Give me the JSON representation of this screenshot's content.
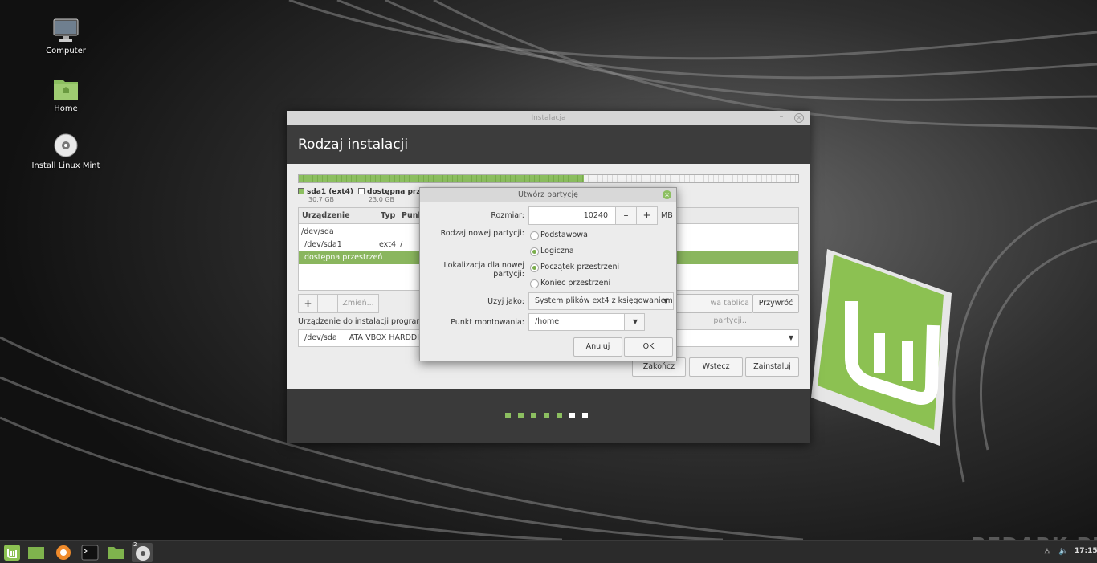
{
  "desktop": {
    "icons": [
      {
        "label": "Computer",
        "icon": "monitor-icon"
      },
      {
        "label": "Home",
        "icon": "home-folder-icon"
      },
      {
        "label": "Install Linux Mint",
        "icon": "disc-icon"
      }
    ]
  },
  "window": {
    "title": "Instalacja",
    "header": "Rodzaj instalacji",
    "partition_bar": {
      "used_fraction": 0.57
    },
    "legend": [
      {
        "name": "sda1 (ext4)",
        "size": "30.7 GB",
        "color": "#8cbf60"
      },
      {
        "name": "dostępna przestrzeń",
        "size": "23.0 GB",
        "color": "#ffffff"
      }
    ],
    "table": {
      "headers": [
        "Urządzenie",
        "Typ",
        "Punkt"
      ],
      "rows": [
        {
          "device": "/dev/sda",
          "type": "",
          "mount": ""
        },
        {
          "device": "/dev/sda1",
          "type": "ext4",
          "mount": "/"
        },
        {
          "device": "dostępna przestrzeń",
          "type": "",
          "mount": "",
          "selected": true
        }
      ]
    },
    "buttons": {
      "add": "+",
      "remove": "–",
      "change": "Zmień...",
      "new_table": "wa tablica partycji...",
      "revert": "Przywróć",
      "quit": "Zakończ",
      "back": "Wstecz",
      "install": "Zainstaluj"
    },
    "bootloader_label": "Urządzenie do instalacji programu r",
    "bootloader_device": "/dev/sda",
    "bootloader_desc": "ATA VBOX HARDDISK (",
    "progress_dots": {
      "total": 7,
      "done": 5,
      "done_color": "#8cbf60",
      "todo_color": "#ffffff"
    }
  },
  "dialog": {
    "title": "Utwórz partycję",
    "size_label": "Rozmiar:",
    "size_value": "10240",
    "size_unit": "MB",
    "minus": "–",
    "plus": "+",
    "type_label": "Rodzaj nowej partycji:",
    "type_options": [
      {
        "label": "Podstawowa",
        "checked": false
      },
      {
        "label": "Logiczna",
        "checked": true
      }
    ],
    "location_label": "Lokalizacja dla nowej partycji:",
    "location_options": [
      {
        "label": "Początek przestrzeni",
        "checked": true
      },
      {
        "label": "Koniec przestrzeni",
        "checked": false
      }
    ],
    "use_as_label": "Użyj jako:",
    "use_as_value": "System plików ext4 z księgowaniem",
    "mount_label": "Punkt montowania:",
    "mount_value": "/home",
    "cancel": "Anuluj",
    "ok": "OK"
  },
  "taskbar": {
    "clock": "17:15",
    "badge": "2"
  },
  "watermark": "REDARK.PL"
}
